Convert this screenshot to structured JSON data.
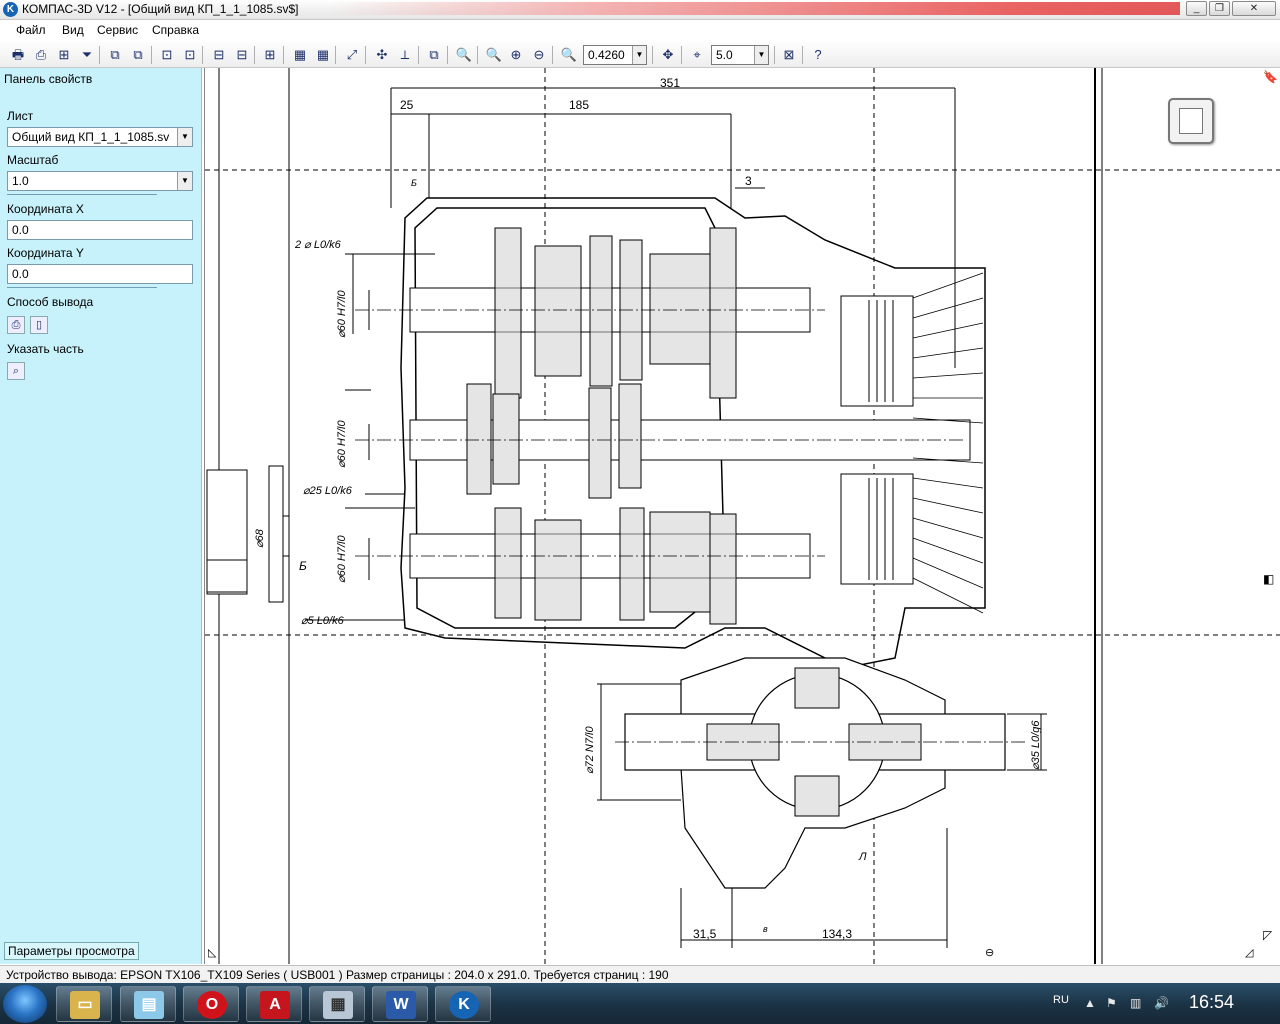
{
  "window": {
    "title": "КОМПАС-3D V12 - [Общий вид КП_1_1_1085.sv$]",
    "app_icon": "kompas-icon"
  },
  "menu": {
    "items": [
      {
        "label": "Файл"
      },
      {
        "label": "Вид"
      },
      {
        "label": "Сервис"
      },
      {
        "label": "Справка"
      }
    ]
  },
  "toolbar": {
    "zoom_value": "0.4260",
    "step_value": "5.0"
  },
  "panel": {
    "title": "Панель свойств",
    "sheet_label": "Лист",
    "sheet_value": "Общий вид КП_1_1_1085.sv",
    "scale_label": "Масштаб",
    "scale_value": "1.0",
    "coord_x_label": "Координата X",
    "coord_x_value": "0.0",
    "coord_y_label": "Координата Y",
    "coord_y_value": "0.0",
    "output_label": "Способ вывода",
    "part_label": "Указать часть",
    "bottom_tab": "Параметры просмотра"
  },
  "drawing": {
    "dims": {
      "total": "351",
      "d25": "25",
      "d185": "185",
      "d3": "3",
      "d31_5": "31,5",
      "d134_3": "134,3"
    },
    "labels": {
      "fit1": "2 ⌀ L0/k6",
      "fit2": "⌀60 H7/l0",
      "fit3": "⌀60 H7/l0",
      "fit4": "⌀25 L0/k6",
      "fit5": "⌀60 H7/l0",
      "fit6": "⌀5 L0/k6",
      "fit7": "⌀68",
      "fit8": "⌀72 N7/l0",
      "fit9": "⌀35 L0/g6",
      "b1": "Б",
      "b2": "Б",
      "v": "в",
      "l": "Л"
    }
  },
  "status": {
    "text": "Устройство вывода: EPSON TX106_TX109 Series ( USB001 )  Размер страницы : 204.0 x 291.0.  Требуется страниц : 190"
  },
  "taskbar": {
    "lang": "RU",
    "clock": "16:54"
  }
}
